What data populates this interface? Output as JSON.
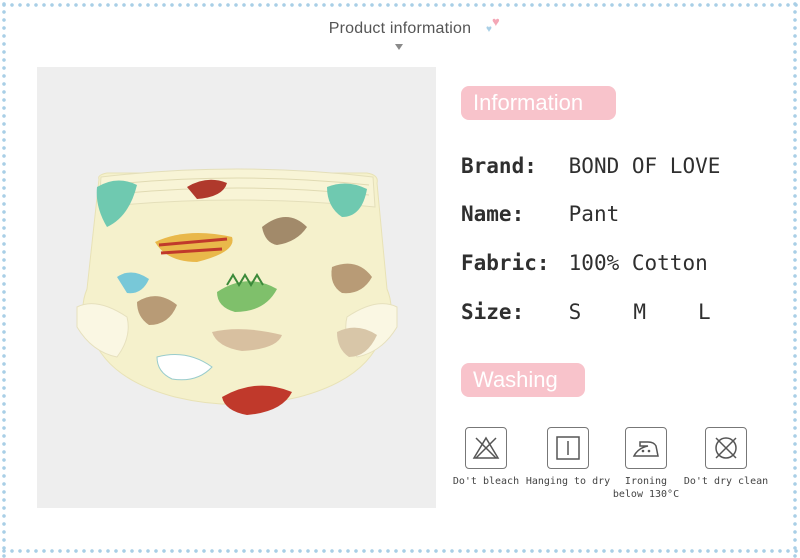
{
  "header": {
    "title": "Product information"
  },
  "colors": {
    "border": "#a9cfe6",
    "pill": "#f8c3cb",
    "photo_bg": "#eeeeee"
  },
  "sections": {
    "information_label": "Information",
    "washing_label": "Washing"
  },
  "info": {
    "brand": {
      "label": "Brand:",
      "value": "BOND OF LOVE"
    },
    "name": {
      "label": "Name:",
      "value": "Pant"
    },
    "fabric": {
      "label": "Fabric:",
      "value": "100% Cotton"
    },
    "size": {
      "label": "Size:",
      "values": [
        "S",
        "M",
        "L"
      ]
    }
  },
  "care": [
    {
      "icon": "no-bleach-icon",
      "label": "Do't bleach"
    },
    {
      "icon": "hang-dry-icon",
      "label": "Hanging to dry"
    },
    {
      "icon": "iron-icon",
      "label_line1": "Ironing",
      "label_line2": "below 130°C"
    },
    {
      "icon": "no-dry-clean-icon",
      "label": "Do't dry clean"
    }
  ]
}
